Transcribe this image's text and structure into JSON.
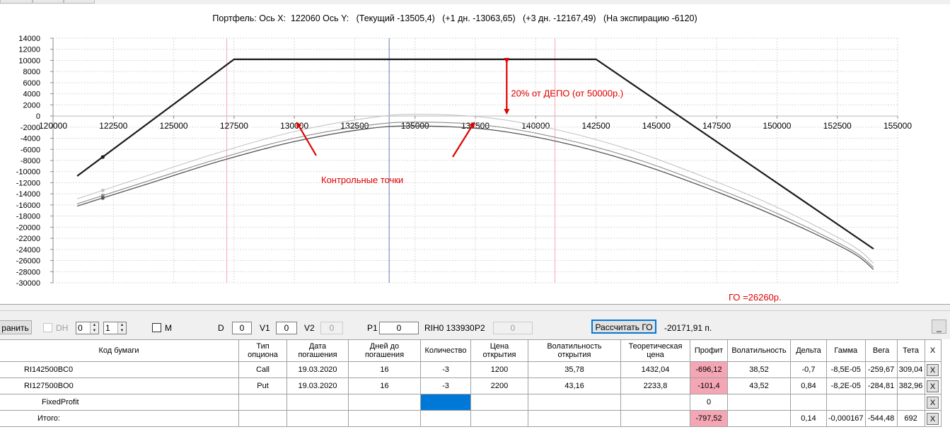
{
  "chart": {
    "title": "Портфель: Ось X:  122060 Ось Y:   (Текущий -13505,4)   (+1 дн. -13063,65)   (+3 дн. -12167,49)   (На экспирацию -6120)",
    "annotation_depo": "20% от ДЕПО (от 50000р.)",
    "annotation_points": "Контрольные точки",
    "colors": {
      "expiration": "#1a1a1a",
      "current": "#555555",
      "day1": "#8a8a8a",
      "day3": "#c4c4c4",
      "vline": "#7f8fb8",
      "strike_line": "#f3a8b8",
      "arrow": "#e00000",
      "grid": "#d9d9d9"
    }
  },
  "chart_data": {
    "type": "line",
    "xlim": [
      120000,
      155000
    ],
    "ylim": [
      -30000,
      14000
    ],
    "x_ticks": [
      "120000",
      "122500",
      "125000",
      "127500",
      "130000",
      "132500",
      "135000",
      "137500",
      "140000",
      "142500",
      "145000",
      "147500",
      "150000",
      "152500",
      "155000"
    ],
    "y_ticks": [
      "14000",
      "12000",
      "10000",
      "8000",
      "6000",
      "4000",
      "2000",
      "0",
      "-2000",
      "-4000",
      "-6000",
      "-8000",
      "-10000",
      "-12000",
      "-14000",
      "-16000",
      "-18000",
      "-20000",
      "-22000",
      "-24000",
      "-26000",
      "-28000",
      "-30000"
    ],
    "cursor_x": 133930,
    "strike_markers_x": [
      127200,
      140800
    ],
    "control_point_x": 122060,
    "series": [
      {
        "key": "expiration",
        "x": [
          121000,
          127500,
          142500,
          154000
        ],
        "y": [
          -10800,
          10200,
          10200,
          -23900
        ]
      },
      {
        "key": "current",
        "x": [
          121000,
          124000,
          127000,
          130000,
          133000,
          135000,
          138000,
          141000,
          144000,
          147000,
          150000,
          153000,
          154000
        ],
        "y": [
          -16200,
          -12100,
          -8000,
          -4600,
          -2300,
          -1800,
          -2400,
          -4700,
          -8200,
          -12800,
          -18100,
          -24300,
          -27600
        ]
      },
      {
        "key": "day1",
        "x": [
          121000,
          124000,
          127000,
          130000,
          133000,
          135000,
          138000,
          141000,
          144000,
          147000,
          150000,
          153000,
          154000
        ],
        "y": [
          -15800,
          -11600,
          -7500,
          -4000,
          -1700,
          -1100,
          -1700,
          -4000,
          -7500,
          -12200,
          -17500,
          -23900,
          -27200
        ]
      },
      {
        "key": "day3",
        "x": [
          121000,
          124000,
          127000,
          130000,
          133000,
          135000,
          138000,
          141000,
          144000,
          147000,
          150000,
          153000,
          154000
        ],
        "y": [
          -14900,
          -10600,
          -6400,
          -2800,
          -400,
          300,
          -300,
          -2600,
          -6200,
          -11000,
          -16400,
          -23000,
          -26500
        ]
      }
    ]
  },
  "toolbar": {
    "save_label": "ранить",
    "dh_label": "DH",
    "spin1": "0",
    "spin2": "1",
    "m_label": "M",
    "d_label": "D",
    "d_value": "0",
    "v1_label": "V1",
    "v1_value": "0",
    "v2_label": "V2",
    "v2_value": "0",
    "p1_label": "P1",
    "p1_value": "0",
    "instrument": "RIH0 133930",
    "p2_label": "P2",
    "p2_value": "0",
    "calc_label": "Рассчитать ГО",
    "go_value": "-20171,91 п.",
    "go_annotation": "ГО =26260р.",
    "minimize_label": "_"
  },
  "table": {
    "headers": [
      "Код бумаги",
      "Тип опциона",
      "Дата погашения",
      "Дней до погашения",
      "Количество",
      "Цена открытия",
      "Волатильность открытия",
      "Теоретическая цена",
      "Профит",
      "Волатильность",
      "Дельта",
      "Гамма",
      "Вега",
      "Тета",
      "X"
    ],
    "rows": [
      [
        "RI142500BC0",
        "Call",
        "19.03.2020",
        "16",
        "-3",
        "1200",
        "35,78",
        "1432,04",
        "-696,12",
        "38,52",
        "-0,7",
        "-8,5E-05",
        "-259,67",
        "309,04",
        "X"
      ],
      [
        "RI127500BO0",
        "Put",
        "19.03.2020",
        "16",
        "-3",
        "2200",
        "43,16",
        "2233,8",
        "-101,4",
        "43,52",
        "0,84",
        "-8,2E-05",
        "-284,81",
        "382,96",
        "X"
      ],
      [
        "FixedProfit",
        "",
        "",
        "",
        "",
        "",
        "",
        "",
        "0",
        "",
        "",
        "",
        "",
        "",
        "X"
      ],
      [
        "Итого:",
        "",
        "",
        "",
        "",
        "",
        "",
        "",
        "-797,52",
        "",
        "0,14",
        "-0,000167",
        "-544,48",
        "692",
        "X"
      ]
    ]
  }
}
